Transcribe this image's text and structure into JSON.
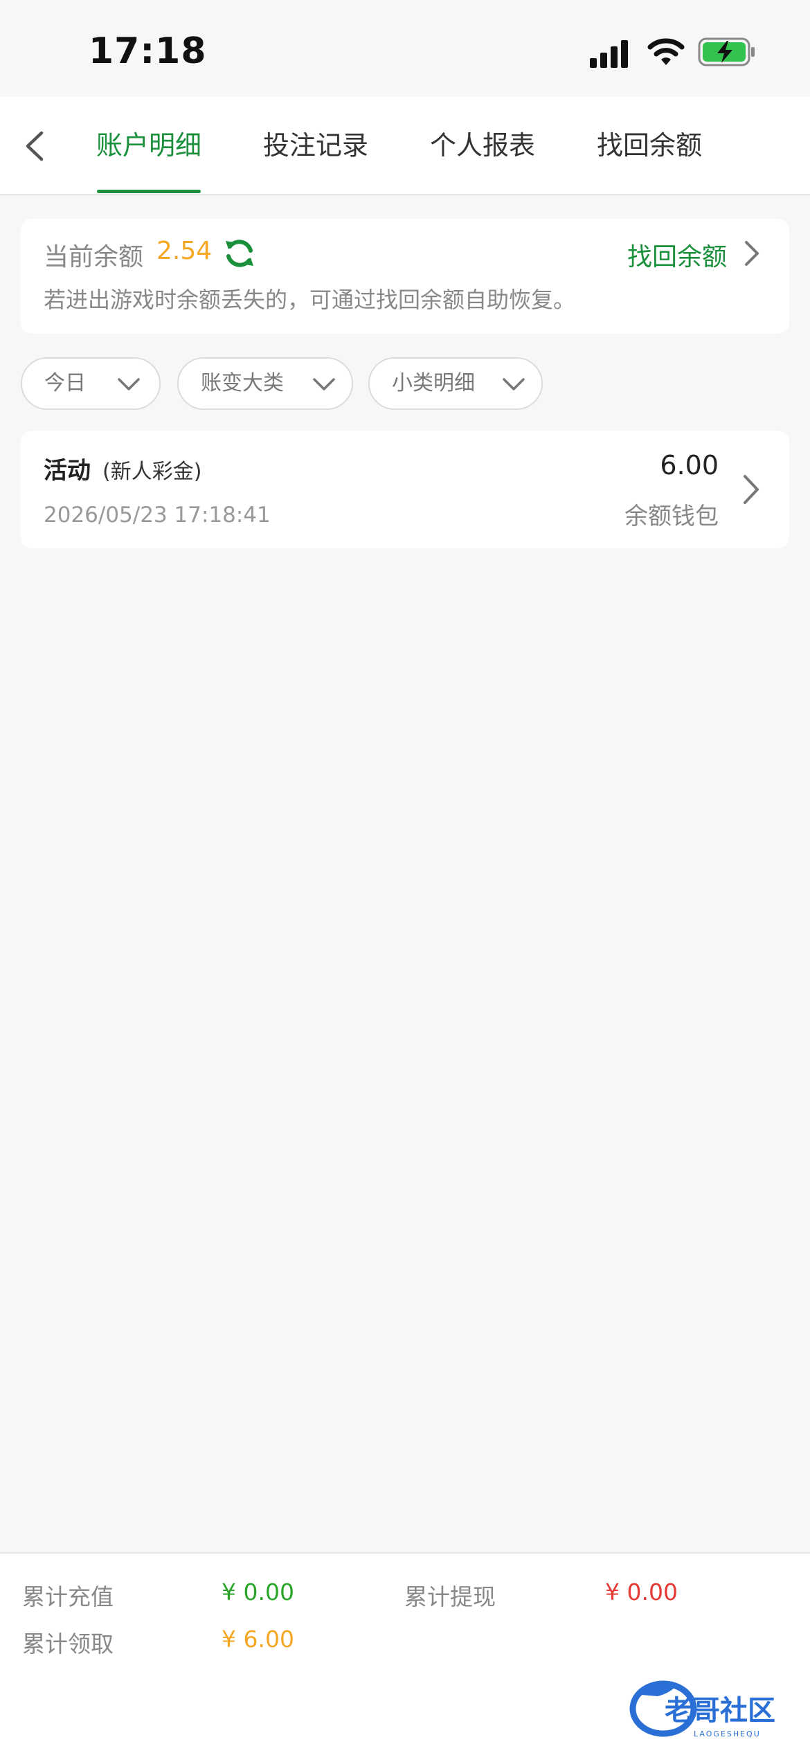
{
  "status_bar": {
    "time": "17:18"
  },
  "nav": {
    "tabs": [
      {
        "label": "账户明细",
        "active": true
      },
      {
        "label": "投注记录",
        "active": false
      },
      {
        "label": "个人报表",
        "active": false
      },
      {
        "label": "找回余额",
        "active": false
      }
    ]
  },
  "balance": {
    "label": "当前余额",
    "value": "2.54",
    "recover_label": "找回余额",
    "hint": "若进出游戏时余额丢失的，可通过找回余额自助恢复。"
  },
  "filters": [
    {
      "label": "今日"
    },
    {
      "label": "账变大类"
    },
    {
      "label": "小类明细"
    }
  ],
  "records": [
    {
      "title": "活动",
      "subtitle": "(新人彩金)",
      "time": "2026/05/23 17:18:41",
      "amount": "6.00",
      "wallet": "余额钱包"
    }
  ],
  "summary": {
    "recharge_label": "累计充值",
    "recharge_value": "¥ 0.00",
    "withdraw_label": "累计提现",
    "withdraw_value": "¥ 0.00",
    "claim_label": "累计领取",
    "claim_value": "¥ 6.00"
  },
  "watermark": {
    "text": "老哥社区",
    "subtext": "LAOGESHEQU"
  },
  "colors": {
    "accent_green": "#1a8f3c",
    "orange": "#f5a623",
    "red": "#e53935",
    "stat_green": "#2aa52a"
  }
}
